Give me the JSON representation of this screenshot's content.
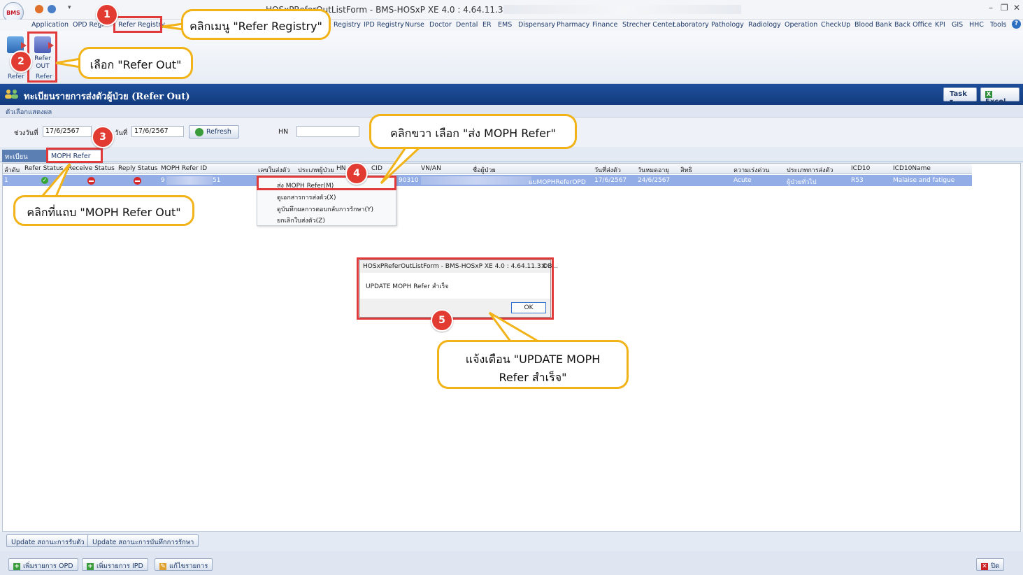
{
  "window": {
    "title": "HOSxPReferOutListForm - BMS-HOSxP XE 4.0 : 4.64.11.3 DB :",
    "logo": "BMS"
  },
  "menu": [
    "Application",
    "OPD Regi",
    "Refer Registry",
    "Registry",
    "IPD Registry",
    "Nurse",
    "Doctor",
    "Dental",
    "ER",
    "EMS",
    "Dispensary",
    "Pharmacy",
    "Finance",
    "Strecher Center",
    "Laboratory",
    "Pathology",
    "Radiology",
    "Operation",
    "CheckUp",
    "Blood Bank",
    "Back Office",
    "KPI",
    "GIS",
    "HHC",
    "Tools"
  ],
  "ribbon": {
    "btn_refer_in": "Refer",
    "btn_refer_out_1": "Refer",
    "btn_refer_out_2": "OUT",
    "group1": "Refer",
    "group2": "Refer"
  },
  "header": {
    "title": "ทะเบียนรายการส่งตัวผู้ป่วย (Refer Out)",
    "task": "Task",
    "excel": "Excel"
  },
  "options_label": "ตัวเลือกแสดงผล",
  "filter": {
    "from_label": "ช่วงวันที่",
    "from_value": "17/6/2567",
    "to_label": "วันที่",
    "to_value": "17/6/2567",
    "refresh": "Refresh",
    "hn_label": "HN",
    "hn_value": ""
  },
  "tabs": [
    "ทะเบียน Local",
    "MOPH Refer Out"
  ],
  "grid": {
    "columns": [
      "ลำดับ",
      "Refer Status",
      "Receive Status",
      "Reply Status",
      "MOPH Refer ID",
      "เลขใบส่งตัว",
      "ประเภทผู้ป่วย",
      "HN",
      "CID",
      "VN/AN",
      "ชื่อผู้ป่วย",
      "วันที่ส่งตัว",
      "วันหมดอายุ",
      "สิทธิ",
      "ความเร่งด่วน",
      "ประเภทการส่งตัว",
      "ICD10",
      "ICD10Name"
    ],
    "rows": [
      {
        "no": "1",
        "refer_id_start": "9",
        "refer_id_end": "51",
        "cid_tail": "90310",
        "name_tail": "แบMOPHReferOPD",
        "refer_date": "17/6/2567",
        "expire_date": "24/6/2567",
        "urgency": "Acute",
        "refer_type": "ผู้ป่วยทั่วไป",
        "icd10": "R53",
        "icd10name": "Malaise and fatigue"
      }
    ]
  },
  "context_menu": [
    "ส่ง MOPH Refer(M)",
    "ดูเอกสารการส่งตัว(X)",
    "ดูบันทึกผลการตอบกลับการรักษา(Y)",
    "ยกเลิกใบส่งตัว(Z)"
  ],
  "bottom_buttons": [
    "Update สถานะการรับตัว",
    "Update สถานะการบันทึกการรักษา"
  ],
  "footer_buttons": [
    "เพิ่มรายการ OPD",
    "เพิ่มรายการ IPD",
    "แก้ไขรายการ",
    "ปิด"
  ],
  "dialog": {
    "title": "HOSxPReferOutListForm - BMS-HOSxP XE 4.0 : 4.64.11.3 DB...",
    "message": "UPDATE MOPH Refer สำเร็จ",
    "ok": "OK"
  },
  "annotations": {
    "step1": "1",
    "step2": "2",
    "step3": "3",
    "step4": "4",
    "step5": "5",
    "callout1": "คลิกเมนู \"Refer Registry\"",
    "callout2": "เลือก \"Refer Out\"",
    "callout3": "คลิกที่แถบ \"MOPH Refer Out\"",
    "callout4": "คลิกขวา เลือก \"ส่ง MOPH Refer\"",
    "callout5_line1": "แจ้งเตือน \"UPDATE MOPH",
    "callout5_line2": "Refer สำเร็จ\""
  },
  "colors": {
    "highlight": "#e03a3a",
    "badge": "#e23b32",
    "callout_border": "#f2b318",
    "header_blue": "#123b7c",
    "selected_row": "#93aee6"
  }
}
